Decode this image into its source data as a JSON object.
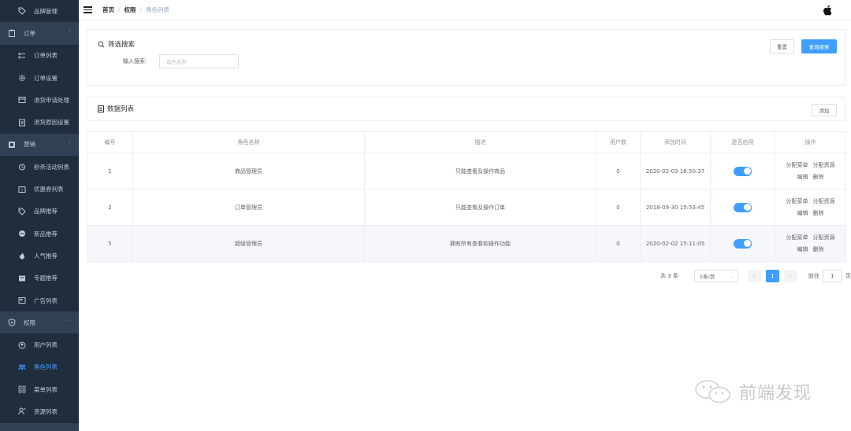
{
  "sidebar": {
    "items": [
      {
        "label": "品牌管理",
        "type": "sub",
        "icon": "tag-icon"
      },
      {
        "label": "订单",
        "type": "group",
        "icon": "clipboard-icon"
      },
      {
        "label": "订单列表",
        "type": "sub",
        "icon": "list-icon"
      },
      {
        "label": "订单设置",
        "type": "sub",
        "icon": "settings-icon"
      },
      {
        "label": "退货申请处理",
        "type": "sub",
        "icon": "return-icon"
      },
      {
        "label": "退货原因设置",
        "type": "sub",
        "icon": "document-icon"
      },
      {
        "label": "营销",
        "type": "group",
        "icon": "marketing-icon"
      },
      {
        "label": "秒杀活动列表",
        "type": "sub",
        "icon": "alarm-icon"
      },
      {
        "label": "优惠券列表",
        "type": "sub",
        "icon": "coupon-icon"
      },
      {
        "label": "品牌推荐",
        "type": "sub",
        "icon": "tag-icon"
      },
      {
        "label": "新品推荐",
        "type": "sub",
        "icon": "new-icon"
      },
      {
        "label": "人气推荐",
        "type": "sub",
        "icon": "fire-icon"
      },
      {
        "label": "专题推荐",
        "type": "sub",
        "icon": "topic-icon"
      },
      {
        "label": "广告列表",
        "type": "sub",
        "icon": "ad-icon"
      },
      {
        "label": "权限",
        "type": "group",
        "icon": "shield-icon"
      },
      {
        "label": "用户列表",
        "type": "sub",
        "icon": "user-icon"
      },
      {
        "label": "角色列表",
        "type": "sub",
        "icon": "role-icon",
        "active": true
      },
      {
        "label": "菜单列表",
        "type": "sub",
        "icon": "menu-icon"
      },
      {
        "label": "资源列表",
        "type": "sub",
        "icon": "resource-icon"
      }
    ]
  },
  "header": {
    "breadcrumb": [
      "首页",
      "权限",
      "角色列表"
    ]
  },
  "search": {
    "title": "筛选搜索",
    "reset_label": "重置",
    "query_label": "查询搜索",
    "input_label": "输入搜索:",
    "input_placeholder": "角色名称"
  },
  "list": {
    "title": "数据列表",
    "add_label": "添加"
  },
  "table": {
    "columns": [
      "编号",
      "角色名称",
      "描述",
      "用户数",
      "添加时间",
      "是否启用",
      "操作"
    ],
    "rows": [
      {
        "id": "1",
        "name": "商品管理员",
        "desc": "只能查看及操作商品",
        "users": "0",
        "time": "2020-02-03 16:50:37",
        "enabled": true
      },
      {
        "id": "2",
        "name": "订单管理员",
        "desc": "只能查看及操作订单",
        "users": "0",
        "time": "2018-09-30 15:53:45",
        "enabled": true
      },
      {
        "id": "5",
        "name": "超级管理员",
        "desc": "拥有所有查看和操作功能",
        "users": "0",
        "time": "2020-02-02 15:11:05",
        "enabled": true
      }
    ],
    "ops": {
      "assign_menu": "分配菜单",
      "assign_resource": "分配资源",
      "edit": "编辑",
      "delete": "删除"
    }
  },
  "pagination": {
    "total": "共 3 条",
    "page_size": "5条/页",
    "current_page": "1",
    "goto_label": "前往",
    "goto_value": "1",
    "page_suffix": "页"
  },
  "watermark": {
    "text": "前端发现"
  },
  "colors": {
    "sidebar_bg": "#304156",
    "sidebar_sub_bg": "#1f2d3d",
    "primary": "#409EFF"
  }
}
